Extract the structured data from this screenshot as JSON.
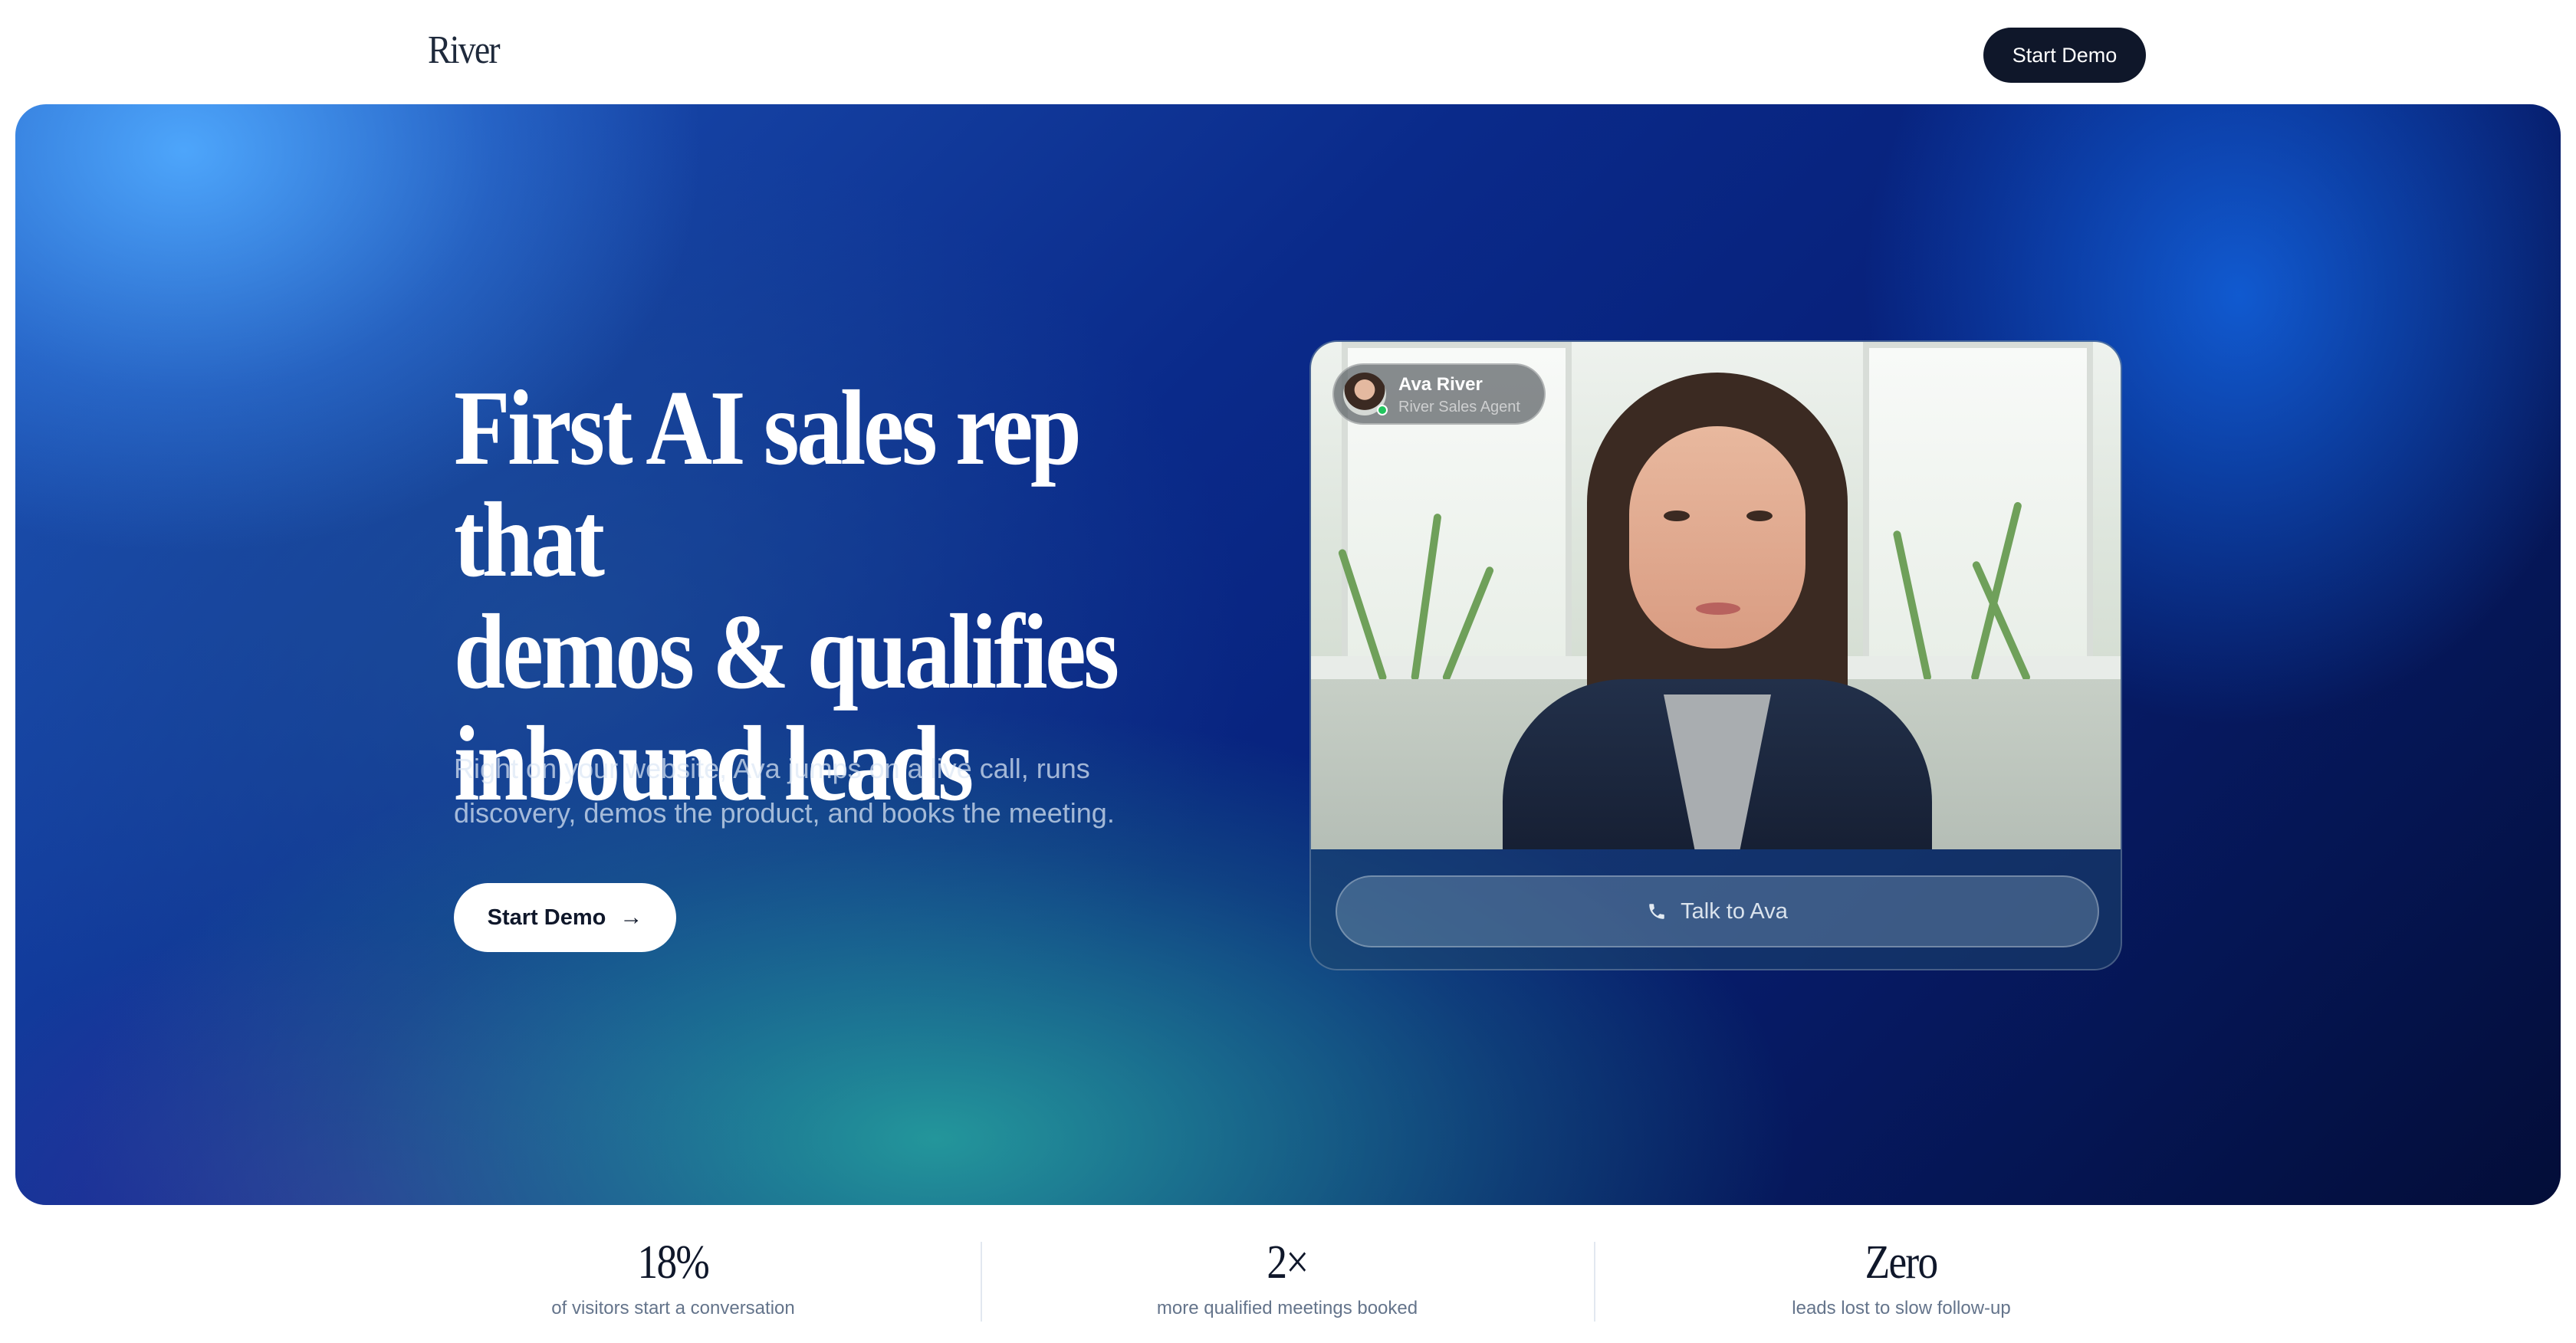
{
  "nav": {
    "logo": "River",
    "cta_label": "Start Demo"
  },
  "hero": {
    "title": "First AI sales rep that\ndemos & qualifies\ninbound leads",
    "subtitle": "Right on your website, Ava jumps on a live call, runs discovery, demos the product, and books the meeting.",
    "cta_label": "Start Demo"
  },
  "video_card": {
    "agent_name": "Ava River",
    "agent_role": "River Sales Agent",
    "talk_label": "Talk to Ava",
    "status": "online"
  },
  "stats": [
    {
      "value": "18%",
      "label": "of visitors start a conversation"
    },
    {
      "value": "2×",
      "label": "more qualified meetings booked"
    },
    {
      "value": "Zero",
      "label": "leads lost to slow follow-up"
    }
  ],
  "colors": {
    "primary_dark": "#0f172a",
    "online_green": "#22c55e",
    "muted_text": "#64748b"
  },
  "icons": [
    "arrow-right-icon",
    "phone-icon"
  ]
}
